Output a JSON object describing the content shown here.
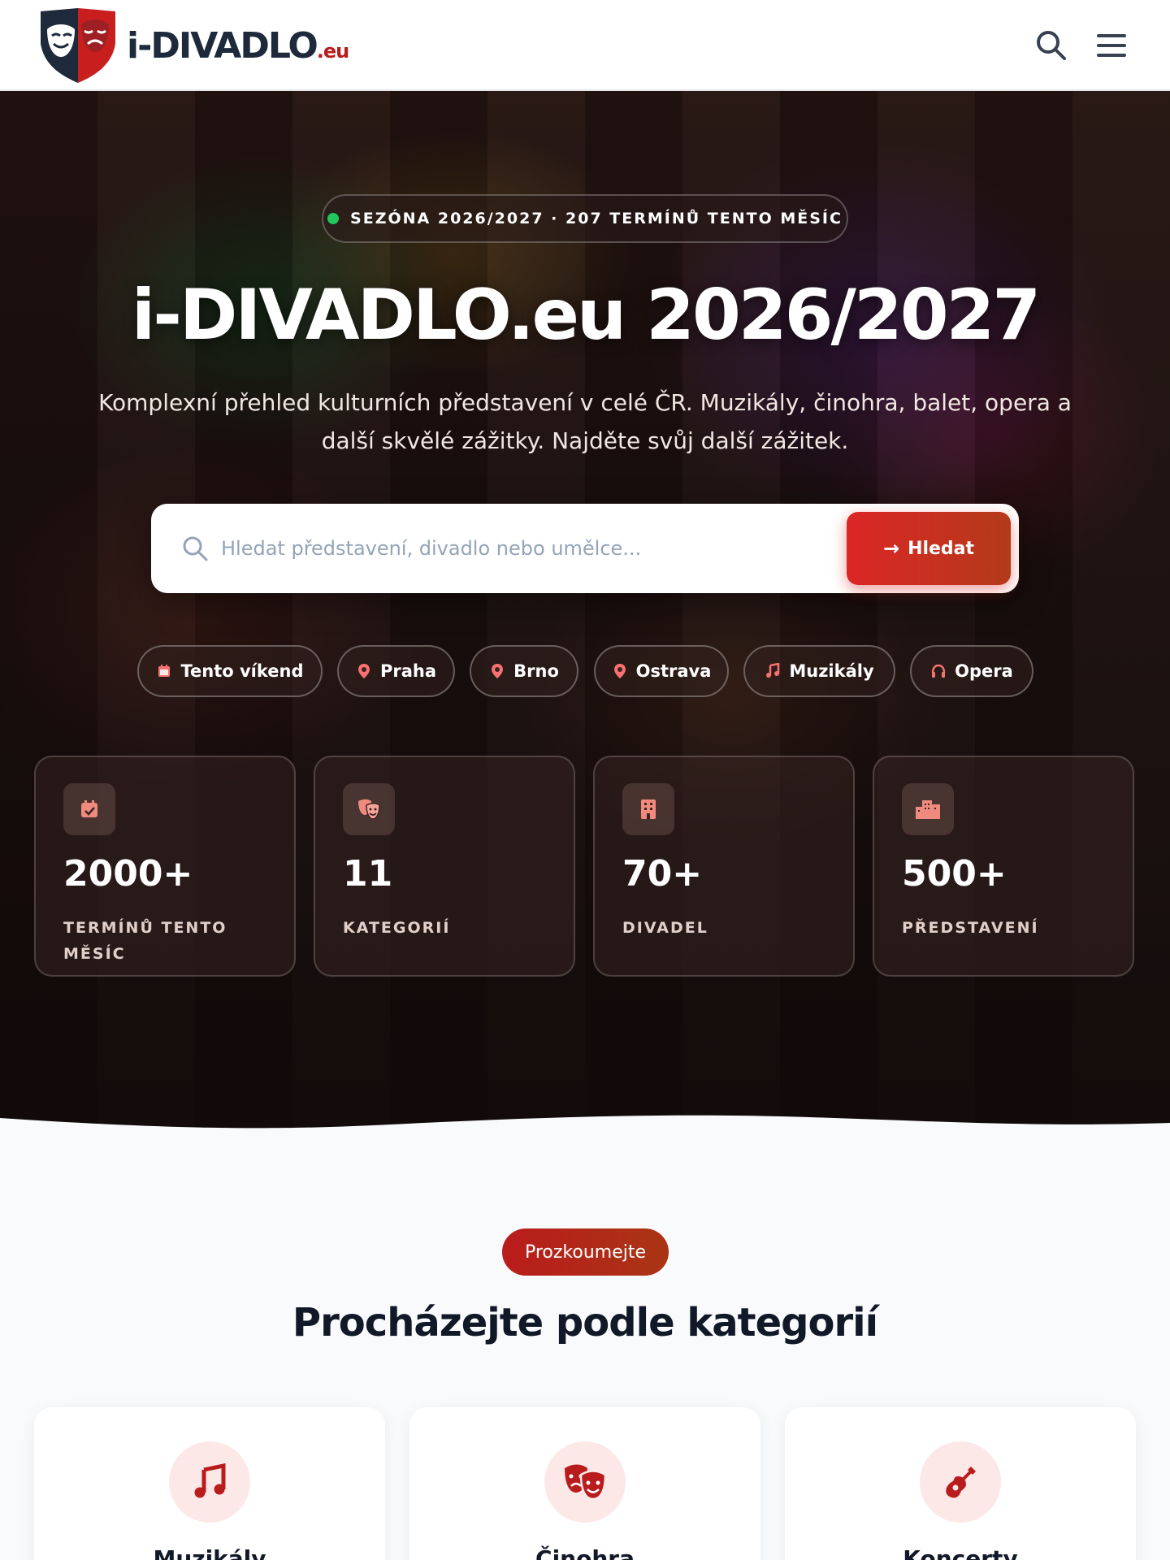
{
  "header": {
    "logo_main": "i-DIVADLO",
    "logo_suffix": ".eu"
  },
  "hero": {
    "season_badge": "SEZÓNA 2026/2027 · 207 TERMÍNŮ TENTO MĚSÍC",
    "title": "i-DIVADLO.eu 2026/2027",
    "subtitle": "Komplexní přehled kulturních představení v celé ČR. Muzikály, činohra, balet, opera a další skvělé zážitky. Najděte svůj další zážitek.",
    "search": {
      "placeholder": "Hledat představení, divadlo nebo umělce...",
      "button_label": "Hledat"
    },
    "quick_filters": [
      {
        "label": "Tento víkend",
        "icon": "calendar-icon"
      },
      {
        "label": "Praha",
        "icon": "map-pin-icon"
      },
      {
        "label": "Brno",
        "icon": "map-pin-icon"
      },
      {
        "label": "Ostrava",
        "icon": "map-pin-icon"
      },
      {
        "label": "Muzikály",
        "icon": "music-note-icon"
      },
      {
        "label": "Opera",
        "icon": "headphones-icon"
      }
    ],
    "stats": [
      {
        "value": "2000+",
        "label": "TERMÍNŮ TENTO MĚSÍC",
        "icon": "calendar-check-icon"
      },
      {
        "value": "11",
        "label": "KATEGORIÍ",
        "icon": "theater-masks-icon"
      },
      {
        "value": "70+",
        "label": "DIVADEL",
        "icon": "building-icon"
      },
      {
        "value": "500+",
        "label": "PŘEDSTAVENÍ",
        "icon": "city-icon"
      }
    ]
  },
  "categories_section": {
    "eyebrow": "Prozkoumejte",
    "title": "Procházejte podle kategorií",
    "items": [
      {
        "label": "Muzikály",
        "icon": "music-note-icon"
      },
      {
        "label": "Činohra",
        "icon": "theater-masks-icon"
      },
      {
        "label": "Koncerty",
        "icon": "guitar-icon"
      }
    ]
  },
  "colors": {
    "accent": "#dc2626",
    "brand_dark": "#1e293b",
    "status_dot": "#22c55e"
  }
}
